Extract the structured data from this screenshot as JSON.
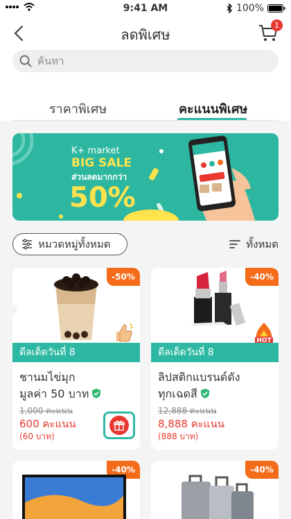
{
  "status_bar": {
    "time": "9:41 AM",
    "battery": "100%"
  },
  "header": {
    "title": "ลดพิเศษ",
    "cart_badge": "1"
  },
  "search": {
    "placeholder": "ค้นหา"
  },
  "tabs": [
    {
      "label": "ราคาพิเศษ",
      "active": false
    },
    {
      "label": "คะแนนพิเศษ",
      "active": true
    }
  ],
  "banner": {
    "line1": "K+ market",
    "line2": "BIG SALE",
    "line3": "ส่วนลดมากกว่า",
    "line4": "50%"
  },
  "filters": {
    "category_label": "หมวดหมู่ทั้งหมด",
    "sort_label": "ทั้งหมด"
  },
  "products": [
    {
      "discount": "-50%",
      "deal": "ดีลเด็ดวันที่ 8",
      "name_line1": "ชานมไข่มุก",
      "name_line2": "มูลค่า 50 บาท",
      "old_points": "1,000 คะแนน",
      "points": "600 คะแนน",
      "baht": "(60 บาท)"
    },
    {
      "discount": "-40%",
      "deal": "ดีลเด็ดวันที่ 8",
      "name_line1": "ลิปสติกแบรนด์ดัง",
      "name_line2": "ทุกเฉดสี",
      "old_points": "12,888 คะแนน",
      "points": "8,888 คะแนน",
      "baht": "(888 บาท)",
      "hot_label": "HOT"
    },
    {
      "discount": "-40%"
    },
    {
      "discount": "-40%"
    }
  ],
  "colors": {
    "accent": "#2db8a3",
    "discount": "#f46b1a",
    "price": "#e8382f"
  }
}
